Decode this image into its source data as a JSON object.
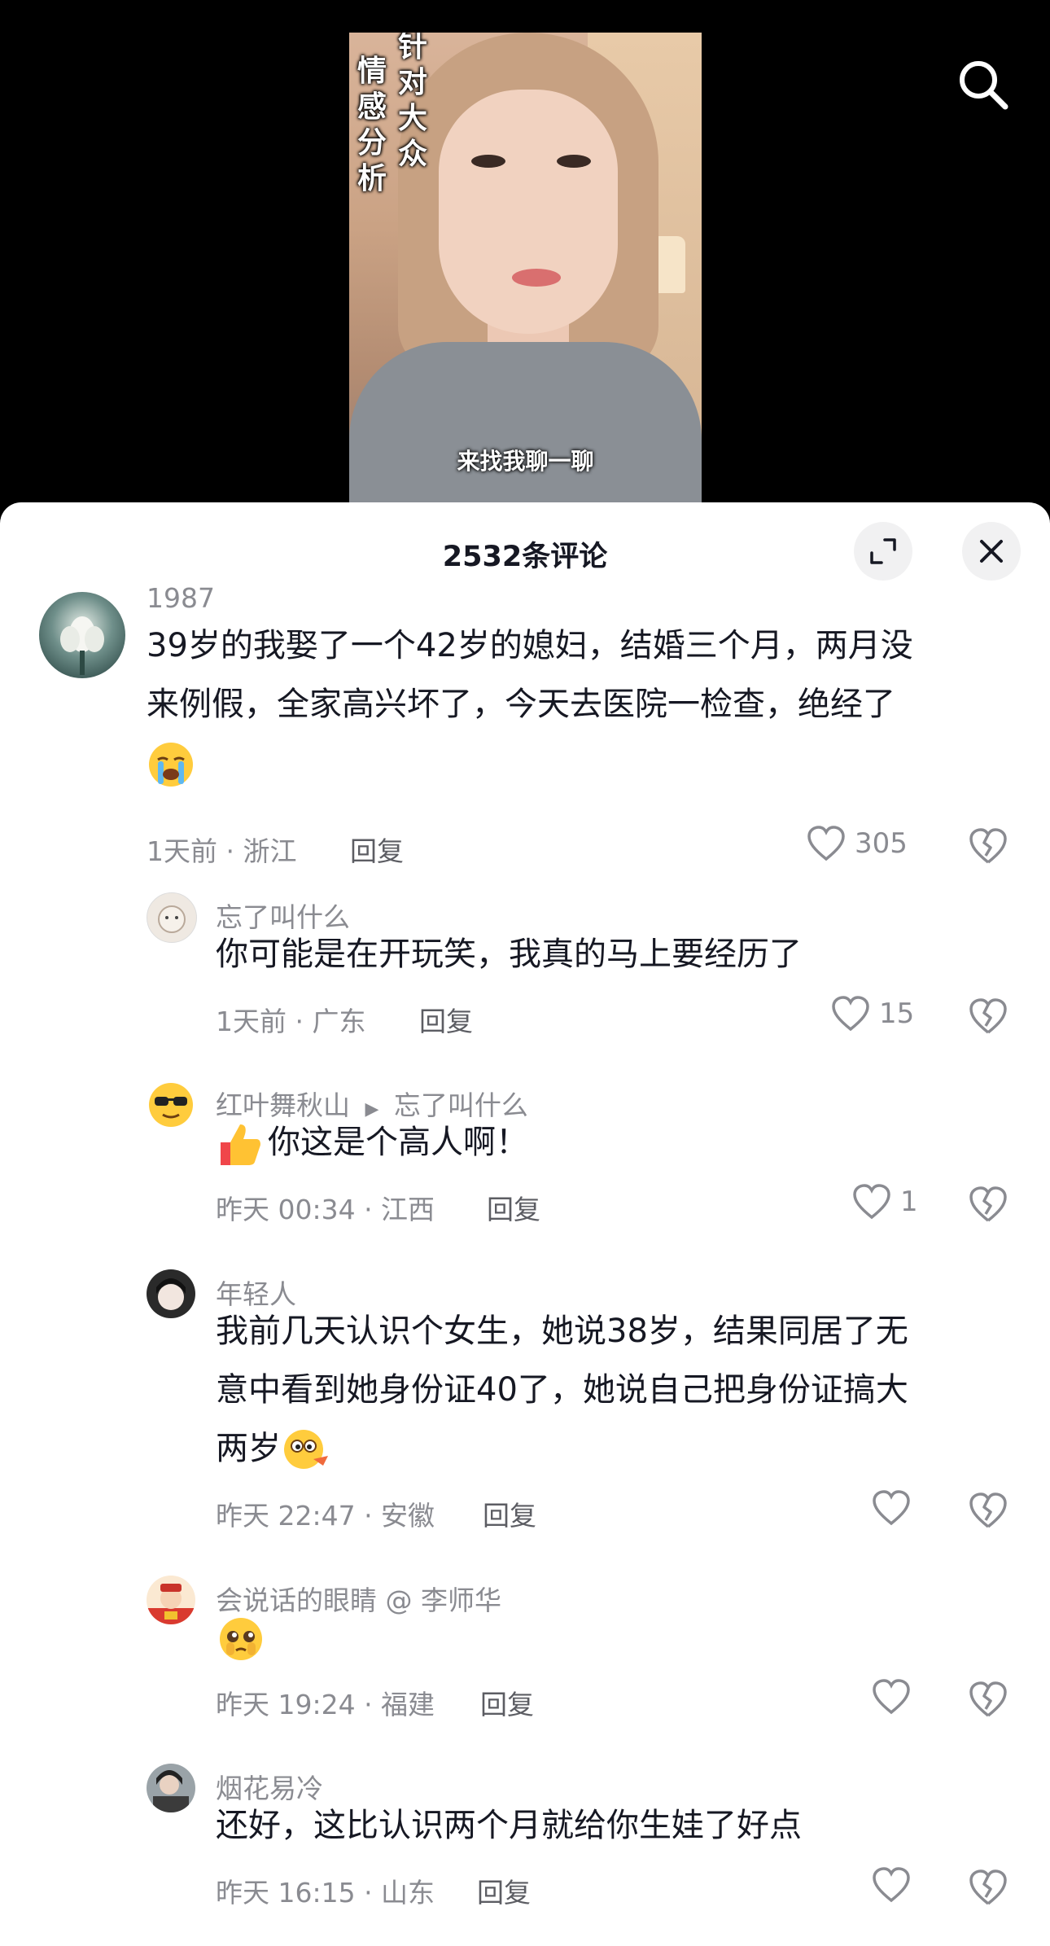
{
  "video": {
    "overlay_col1": "情感分析",
    "overlay_col2": "针对大众",
    "subtitle": "来找我聊一聊"
  },
  "header": {
    "comment_count_title": "2532条评论",
    "icons": [
      "search-icon",
      "expand-icon",
      "close-icon"
    ]
  },
  "comments": [
    {
      "user": "1987",
      "text_line1": "39岁的我娶了一个42岁的媳妇，结婚三个月，两月没",
      "text_line2": "来例假，全家高兴坏了，今天去医院一检查，绝经了",
      "emoji": "loudly-crying-face",
      "meta": "1天前 · 浙江",
      "reply_label": "回复",
      "likes": "305"
    },
    {
      "user": "忘了叫什么",
      "text": "你可能是在开玩笑，我真的马上要经历了",
      "meta": "1天前 · 广东",
      "reply_label": "回复",
      "likes": "15"
    },
    {
      "user": "红叶舞秋山",
      "reply_to": "忘了叫什么",
      "text": "你这是个高人啊！",
      "emoji": "thumbs-up",
      "meta": "昨天 00:34 · 江西",
      "reply_label": "回复",
      "likes": "1"
    },
    {
      "user": "年轻人",
      "text_line1": "我前几天认识个女生，她说38岁，结果同居了无",
      "text_line2": "意中看到她身份证40了，她说自己把身份证搞大",
      "text_line3": "两岁",
      "emoji": "puzzled-face",
      "meta": "昨天 22:47 · 安徽",
      "reply_label": "回复",
      "likes": ""
    },
    {
      "user": "会说话的眼睛 @ 李师华",
      "emoji": "pleading-face",
      "meta": "昨天 19:24 · 福建",
      "reply_label": "回复",
      "likes": ""
    },
    {
      "user": "烟花易冷",
      "text": "还好，这比认识两个月就给你生娃了好点",
      "meta": "昨天 16:15 · 山东",
      "reply_label": "回复",
      "likes": ""
    }
  ],
  "colors": {
    "text_primary": "#161823",
    "text_secondary": "#8a8b91",
    "sheet_bg": "#ffffff",
    "video_bg": "#000000"
  }
}
